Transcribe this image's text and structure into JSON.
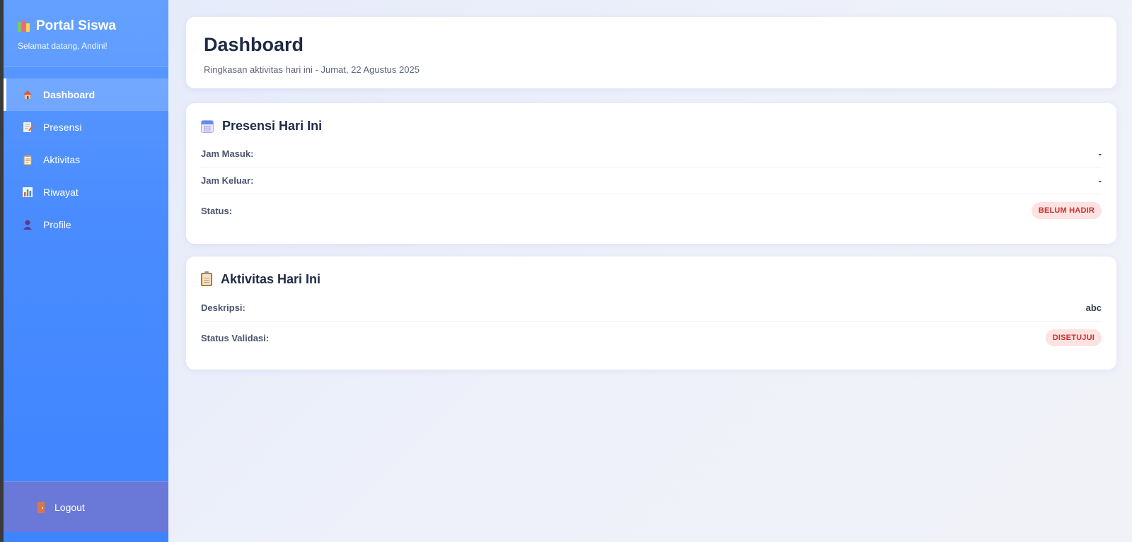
{
  "sidebar": {
    "brand_title": "Portal Siswa",
    "brand_subtitle": "Selamat datang, Andini!",
    "items": [
      {
        "label": "Dashboard",
        "icon": "home-icon",
        "active": true
      },
      {
        "label": "Presensi",
        "icon": "memo-icon",
        "active": false
      },
      {
        "label": "Aktivitas",
        "icon": "clipboard-icon",
        "active": false
      },
      {
        "label": "Riwayat",
        "icon": "bar-chart-icon",
        "active": false
      },
      {
        "label": "Profile",
        "icon": "user-icon",
        "active": false
      }
    ],
    "logout_label": "Logout"
  },
  "header": {
    "title": "Dashboard",
    "subtitle": "Ringkasan aktivitas hari ini - Jumat, 22 Agustus 2025"
  },
  "presensi": {
    "title": "Presensi Hari Ini",
    "rows": [
      {
        "label": "Jam Masuk:",
        "value": "-"
      },
      {
        "label": "Jam Keluar:",
        "value": "-"
      },
      {
        "label": "Status:",
        "value": "BELUM HADIR"
      }
    ]
  },
  "aktivitas": {
    "title": "Aktivitas Hari Ini",
    "rows": [
      {
        "label": "Deskripsi:",
        "value": "abc"
      },
      {
        "label": "Status Validasi:",
        "value": "DISETUJUI"
      }
    ]
  },
  "colors": {
    "sidebar": "#4a8cff",
    "logout_bg": "#6a78d8",
    "badge_bg": "#fde2e2",
    "badge_text": "#c9302c",
    "heading": "#1f2a44"
  }
}
